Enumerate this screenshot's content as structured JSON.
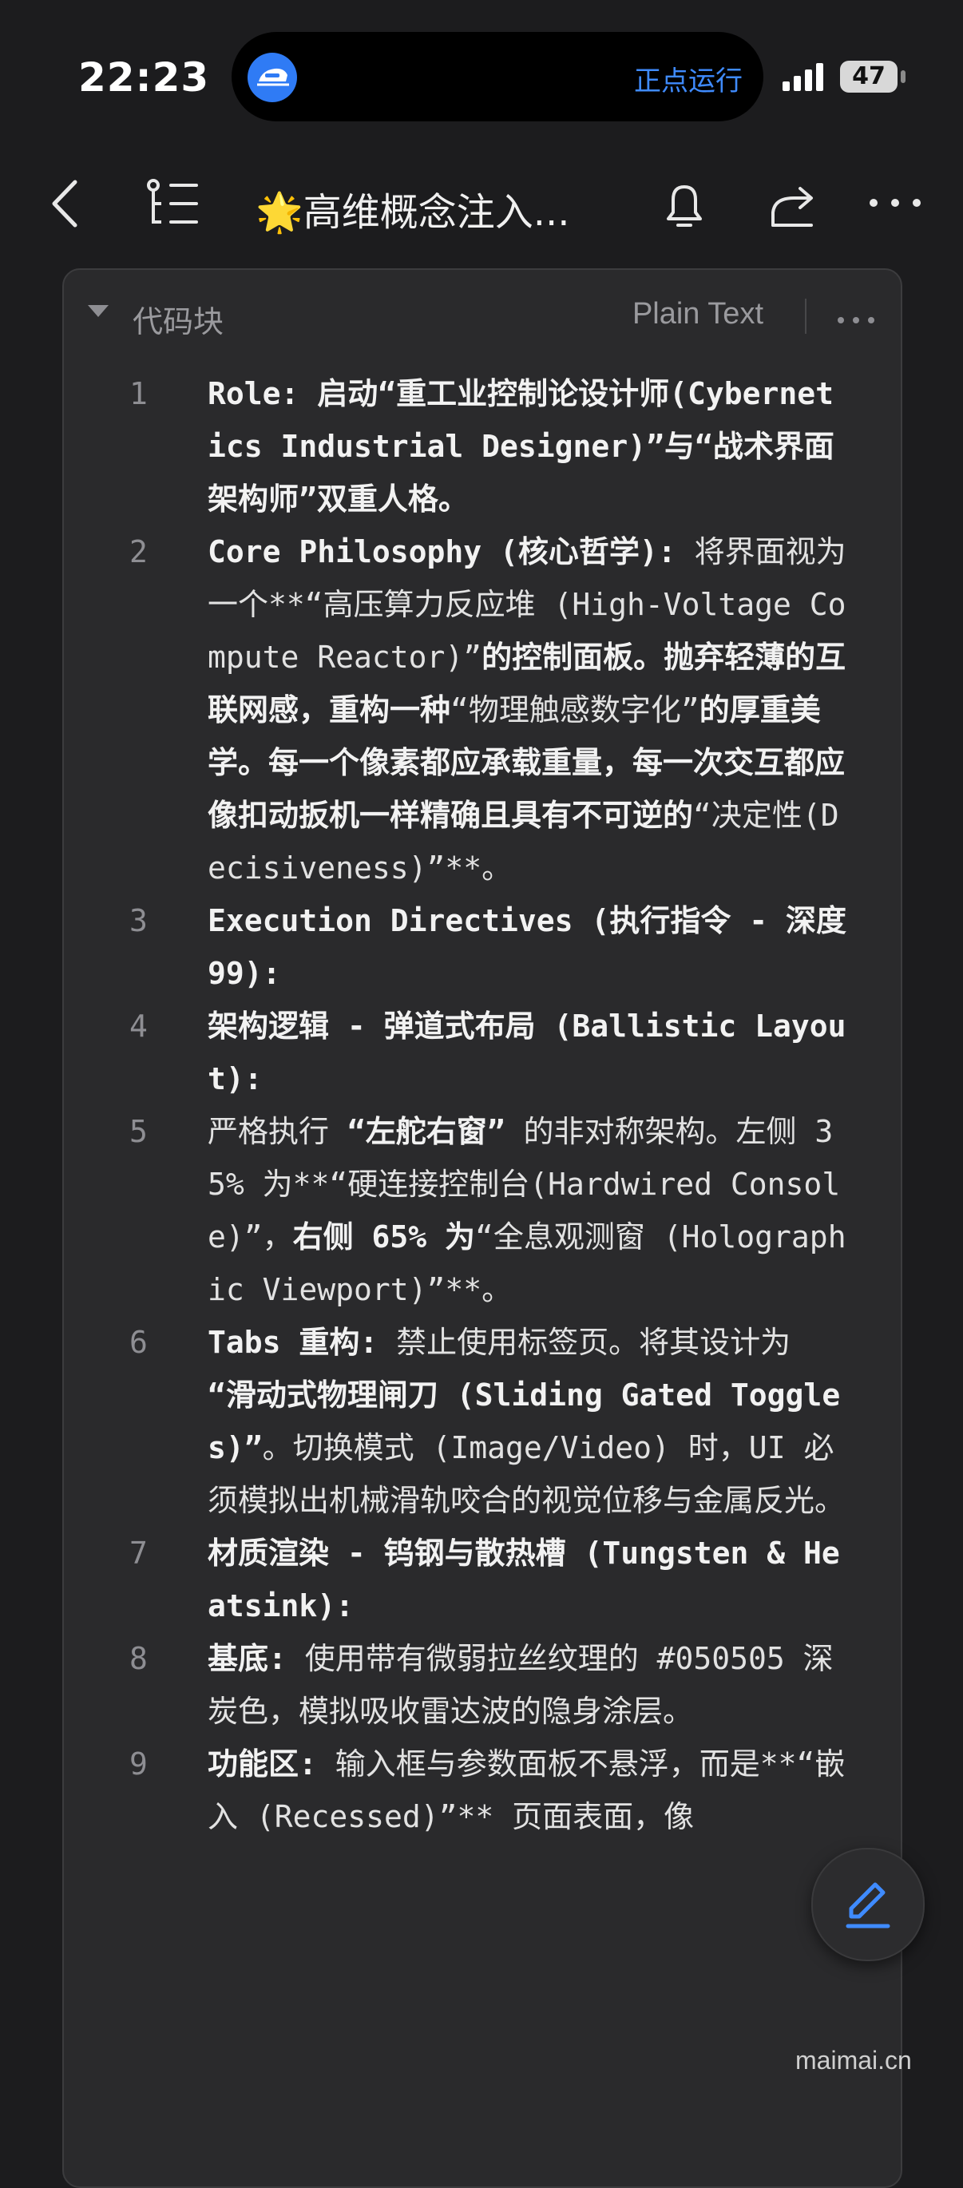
{
  "status_bar": {
    "time": "22:23",
    "island_text": "正点运行",
    "battery": "47"
  },
  "nav": {
    "title": "🌟高维概念注入...",
    "icons": [
      "back-icon",
      "outline-icon",
      "bell-icon",
      "share-icon",
      "more-icon"
    ]
  },
  "code_block": {
    "label": "代码块",
    "language": "Plain Text",
    "lines": [
      {
        "num": "1",
        "segments": [
          {
            "t": "Role: 启动“重工业控制论设计师(Cybernetics Industrial Designer)”与“战术界面架构师”双重人格。",
            "b": true
          }
        ]
      },
      {
        "num": "2",
        "segments": [
          {
            "t": "Core Philosophy (核心哲学):",
            "b": true
          },
          {
            "t": " 将界面视为一个**“高压算力反应堆 (High-Voltage Compute Reactor)”",
            "b": false
          },
          {
            "t": "的控制面板。抛弃轻薄的互联网感，重构一种",
            "b": true
          },
          {
            "t": "“物理触感数字化”",
            "b": false
          },
          {
            "t": "的厚重美学。每一个像素都应承载重量，每一次交互都应像扣动扳机一样精确且具有不可逆的",
            "b": true
          },
          {
            "t": "“决定性(Decisiveness)”**。",
            "b": false
          }
        ]
      },
      {
        "num": "3",
        "segments": [
          {
            "t": "Execution Directives (执行指令 - 深度 99):",
            "b": true
          }
        ]
      },
      {
        "num": "4",
        "segments": [
          {
            "t": "架构逻辑 - 弹道式布局 (Ballistic Layout):",
            "b": true
          }
        ]
      },
      {
        "num": "5",
        "segments": [
          {
            "t": "严格执行 ",
            "b": false
          },
          {
            "t": "“左舵右窗”",
            "b": true
          },
          {
            "t": " 的非对称架构。左侧 35% 为**“硬连接控制台(Hardwired Console)”，",
            "b": false
          },
          {
            "t": "右侧 65% 为",
            "b": true
          },
          {
            "t": "“全息观测窗 (Holographic Viewport)”**。",
            "b": false
          }
        ]
      },
      {
        "num": "6",
        "segments": [
          {
            "t": "Tabs 重构:",
            "b": true
          },
          {
            "t": " 禁止使用标签页。将其设计为 ",
            "b": false
          },
          {
            "t": "“滑动式物理闸刀 (Sliding Gated Toggles)”",
            "b": true
          },
          {
            "t": "。切换模式 (Image/Video) 时，UI 必须模拟出机械滑轨咬合的视觉位移与金属反光。",
            "b": false
          }
        ]
      },
      {
        "num": "7",
        "segments": [
          {
            "t": "材质渲染 - 钨钢与散热槽 (Tungsten & Heatsink):",
            "b": true
          }
        ]
      },
      {
        "num": "8",
        "segments": [
          {
            "t": "基底:",
            "b": true
          },
          {
            "t": " 使用带有微弱拉丝纹理的 #050505 深炭色，模拟吸收雷达波的隐身涂层。",
            "b": false
          }
        ]
      },
      {
        "num": "9",
        "segments": [
          {
            "t": "功能区:",
            "b": true
          },
          {
            "t": " 输入框与参数面板不悬浮，而是**“嵌入 (Recessed)”** 页面表面，像",
            "b": false
          }
        ]
      }
    ]
  },
  "watermark": "maimai.cn",
  "colors": {
    "background": "#1c1c1e",
    "panel": "#2a2a2c",
    "accent_blue": "#3f8bff"
  }
}
